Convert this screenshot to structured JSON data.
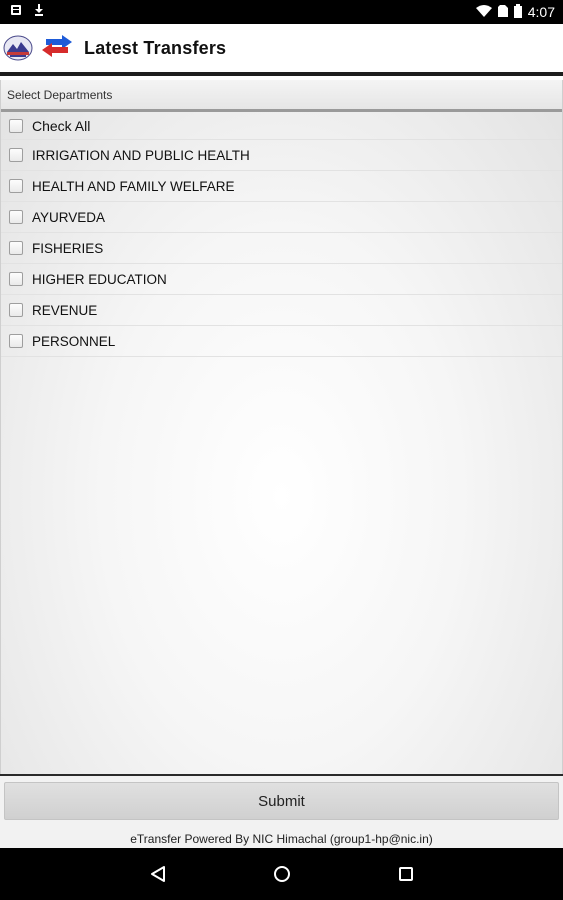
{
  "status_bar": {
    "time": "4:07",
    "icons": [
      "notification-icon",
      "download-icon",
      "wifi-icon",
      "sim-icon",
      "battery-icon"
    ]
  },
  "app_bar": {
    "title": "Latest Transfers",
    "icons": [
      "hp-logo-icon",
      "transfer-arrows-icon"
    ]
  },
  "section": {
    "header": "Select Departments"
  },
  "departments": [
    {
      "label": "Check All",
      "checked": false
    },
    {
      "label": "IRRIGATION AND PUBLIC HEALTH",
      "checked": false
    },
    {
      "label": "HEALTH AND FAMILY WELFARE",
      "checked": false
    },
    {
      "label": "AYURVEDA",
      "checked": false
    },
    {
      "label": "FISHERIES",
      "checked": false
    },
    {
      "label": "HIGHER EDUCATION",
      "checked": false
    },
    {
      "label": "REVENUE",
      "checked": false
    },
    {
      "label": "PERSONNEL",
      "checked": false
    }
  ],
  "footer": {
    "submit_label": "Submit",
    "credit": "eTransfer Powered By NIC Himachal (group1-hp@nic.in)"
  },
  "nav_bar": {
    "icons": [
      "back-icon",
      "home-icon",
      "recents-icon"
    ]
  },
  "colors": {
    "transfer_arrow_blue": "#1e5bd8",
    "transfer_arrow_red": "#d62b2b"
  }
}
